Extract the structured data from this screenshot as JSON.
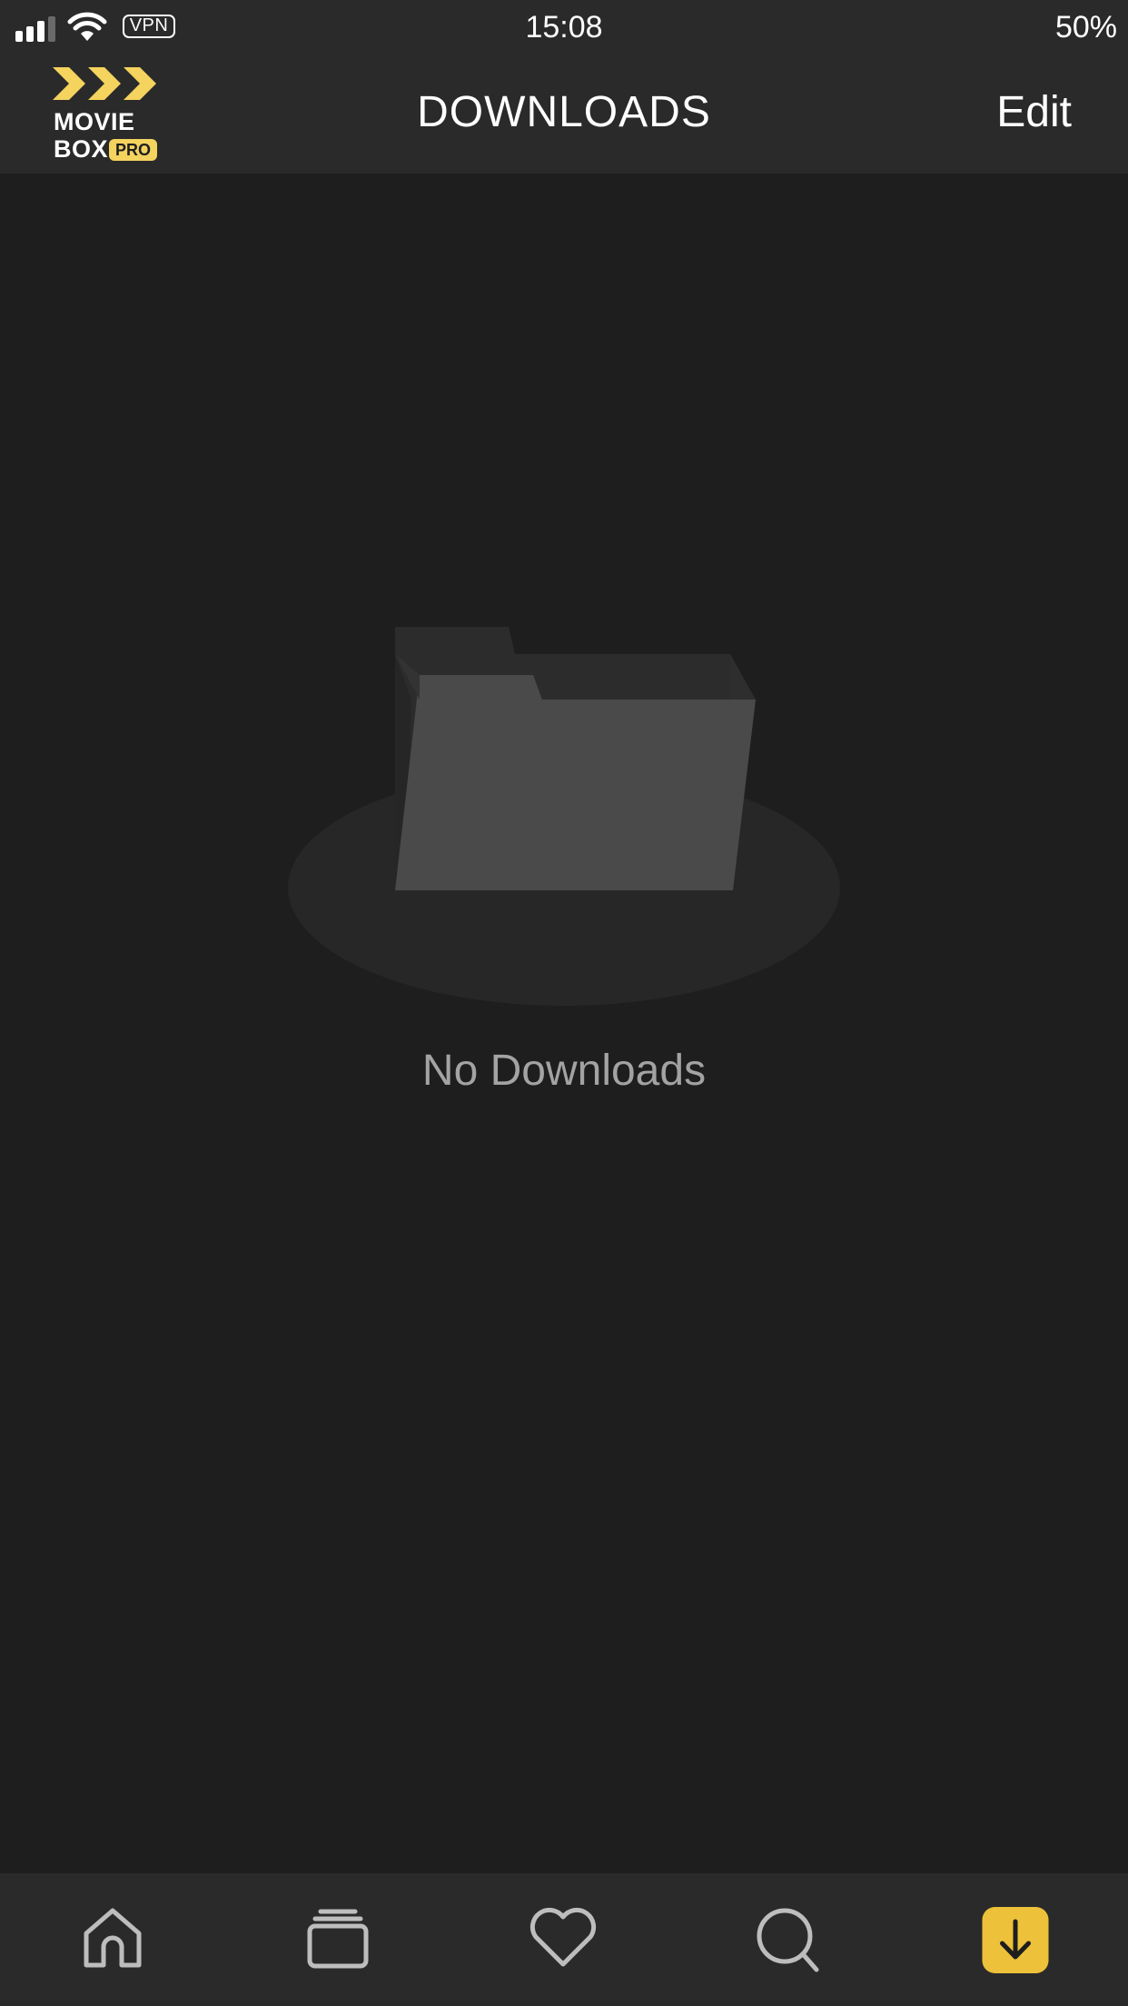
{
  "status_bar": {
    "vpn": "VPN",
    "time": "15:08",
    "battery": "50%"
  },
  "header": {
    "logo": {
      "line1": "MOVIE",
      "line2": "BOX",
      "badge": "PRO"
    },
    "title": "DOWNLOADS",
    "edit_label": "Edit"
  },
  "empty_state": {
    "icon": "empty-folder-icon",
    "message": "No Downloads"
  },
  "tab_bar": {
    "tabs": [
      {
        "icon": "home-icon",
        "active": false
      },
      {
        "icon": "collections-icon",
        "active": false
      },
      {
        "icon": "heart-icon",
        "active": false
      },
      {
        "icon": "search-icon",
        "active": false
      },
      {
        "icon": "download-icon",
        "active": true
      }
    ]
  },
  "colors": {
    "background": "#1e1e1e",
    "bar": "#2a2a2a",
    "accent": "#eec13a",
    "logo_yellow": "#f4d35e",
    "muted_text": "#a3a3a3",
    "icon_gray": "#bdbdbd"
  }
}
